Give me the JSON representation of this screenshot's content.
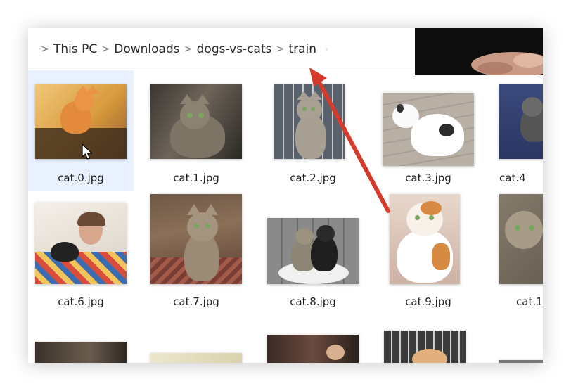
{
  "breadcrumb": {
    "items": [
      "This PC",
      "Downloads",
      "dogs-vs-cats",
      "train"
    ],
    "separator": ">"
  },
  "files": [
    {
      "name": "cat.0.jpg"
    },
    {
      "name": "cat.1.jpg"
    },
    {
      "name": "cat.2.jpg"
    },
    {
      "name": "cat.3.jpg"
    },
    {
      "name": "cat.4"
    },
    {
      "name": "cat.6.jpg"
    },
    {
      "name": "cat.7.jpg"
    },
    {
      "name": "cat.8.jpg"
    },
    {
      "name": "cat.9.jpg"
    },
    {
      "name": "cat.1"
    }
  ],
  "colors": {
    "selection": "#e8f1fd",
    "annotation_arrow": "#d53a2a"
  },
  "icons": {
    "cursor": "mouse-pointer-icon",
    "separator": "chevron-right-icon"
  }
}
